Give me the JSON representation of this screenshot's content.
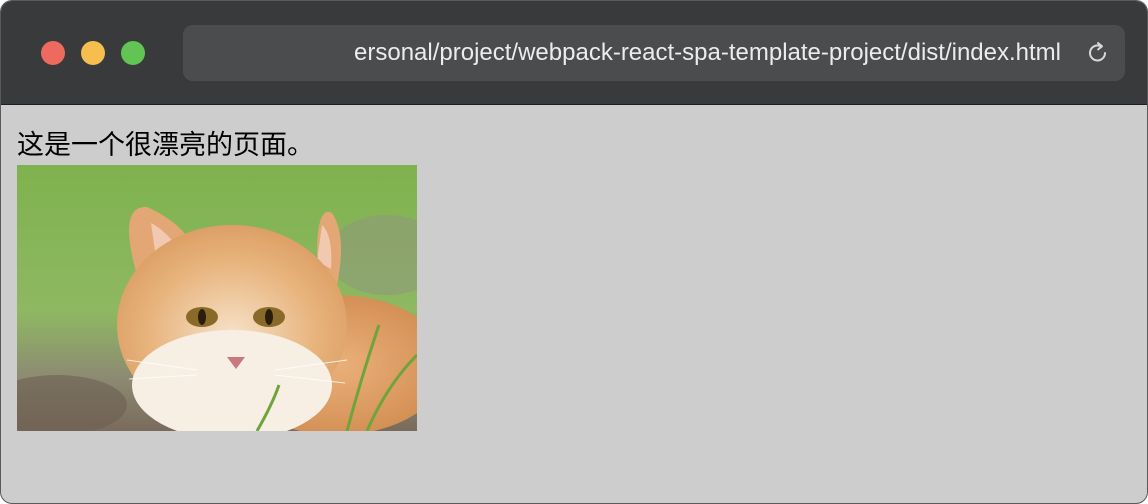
{
  "browser": {
    "url": "ersonal/project/webpack-react-spa-template-project/dist/index.html",
    "reload_icon": "reload-icon",
    "traffic_lights": {
      "close": "#ee6a5f",
      "minimize": "#f5be4f",
      "maximize": "#61c454"
    }
  },
  "page": {
    "heading": "这是一个很漂亮的页面。",
    "image_subject": "cat-photo"
  },
  "colors": {
    "titlebar": "#383a3b",
    "urlbar": "#4a4c4e",
    "page_background": "#cdcdcd"
  }
}
